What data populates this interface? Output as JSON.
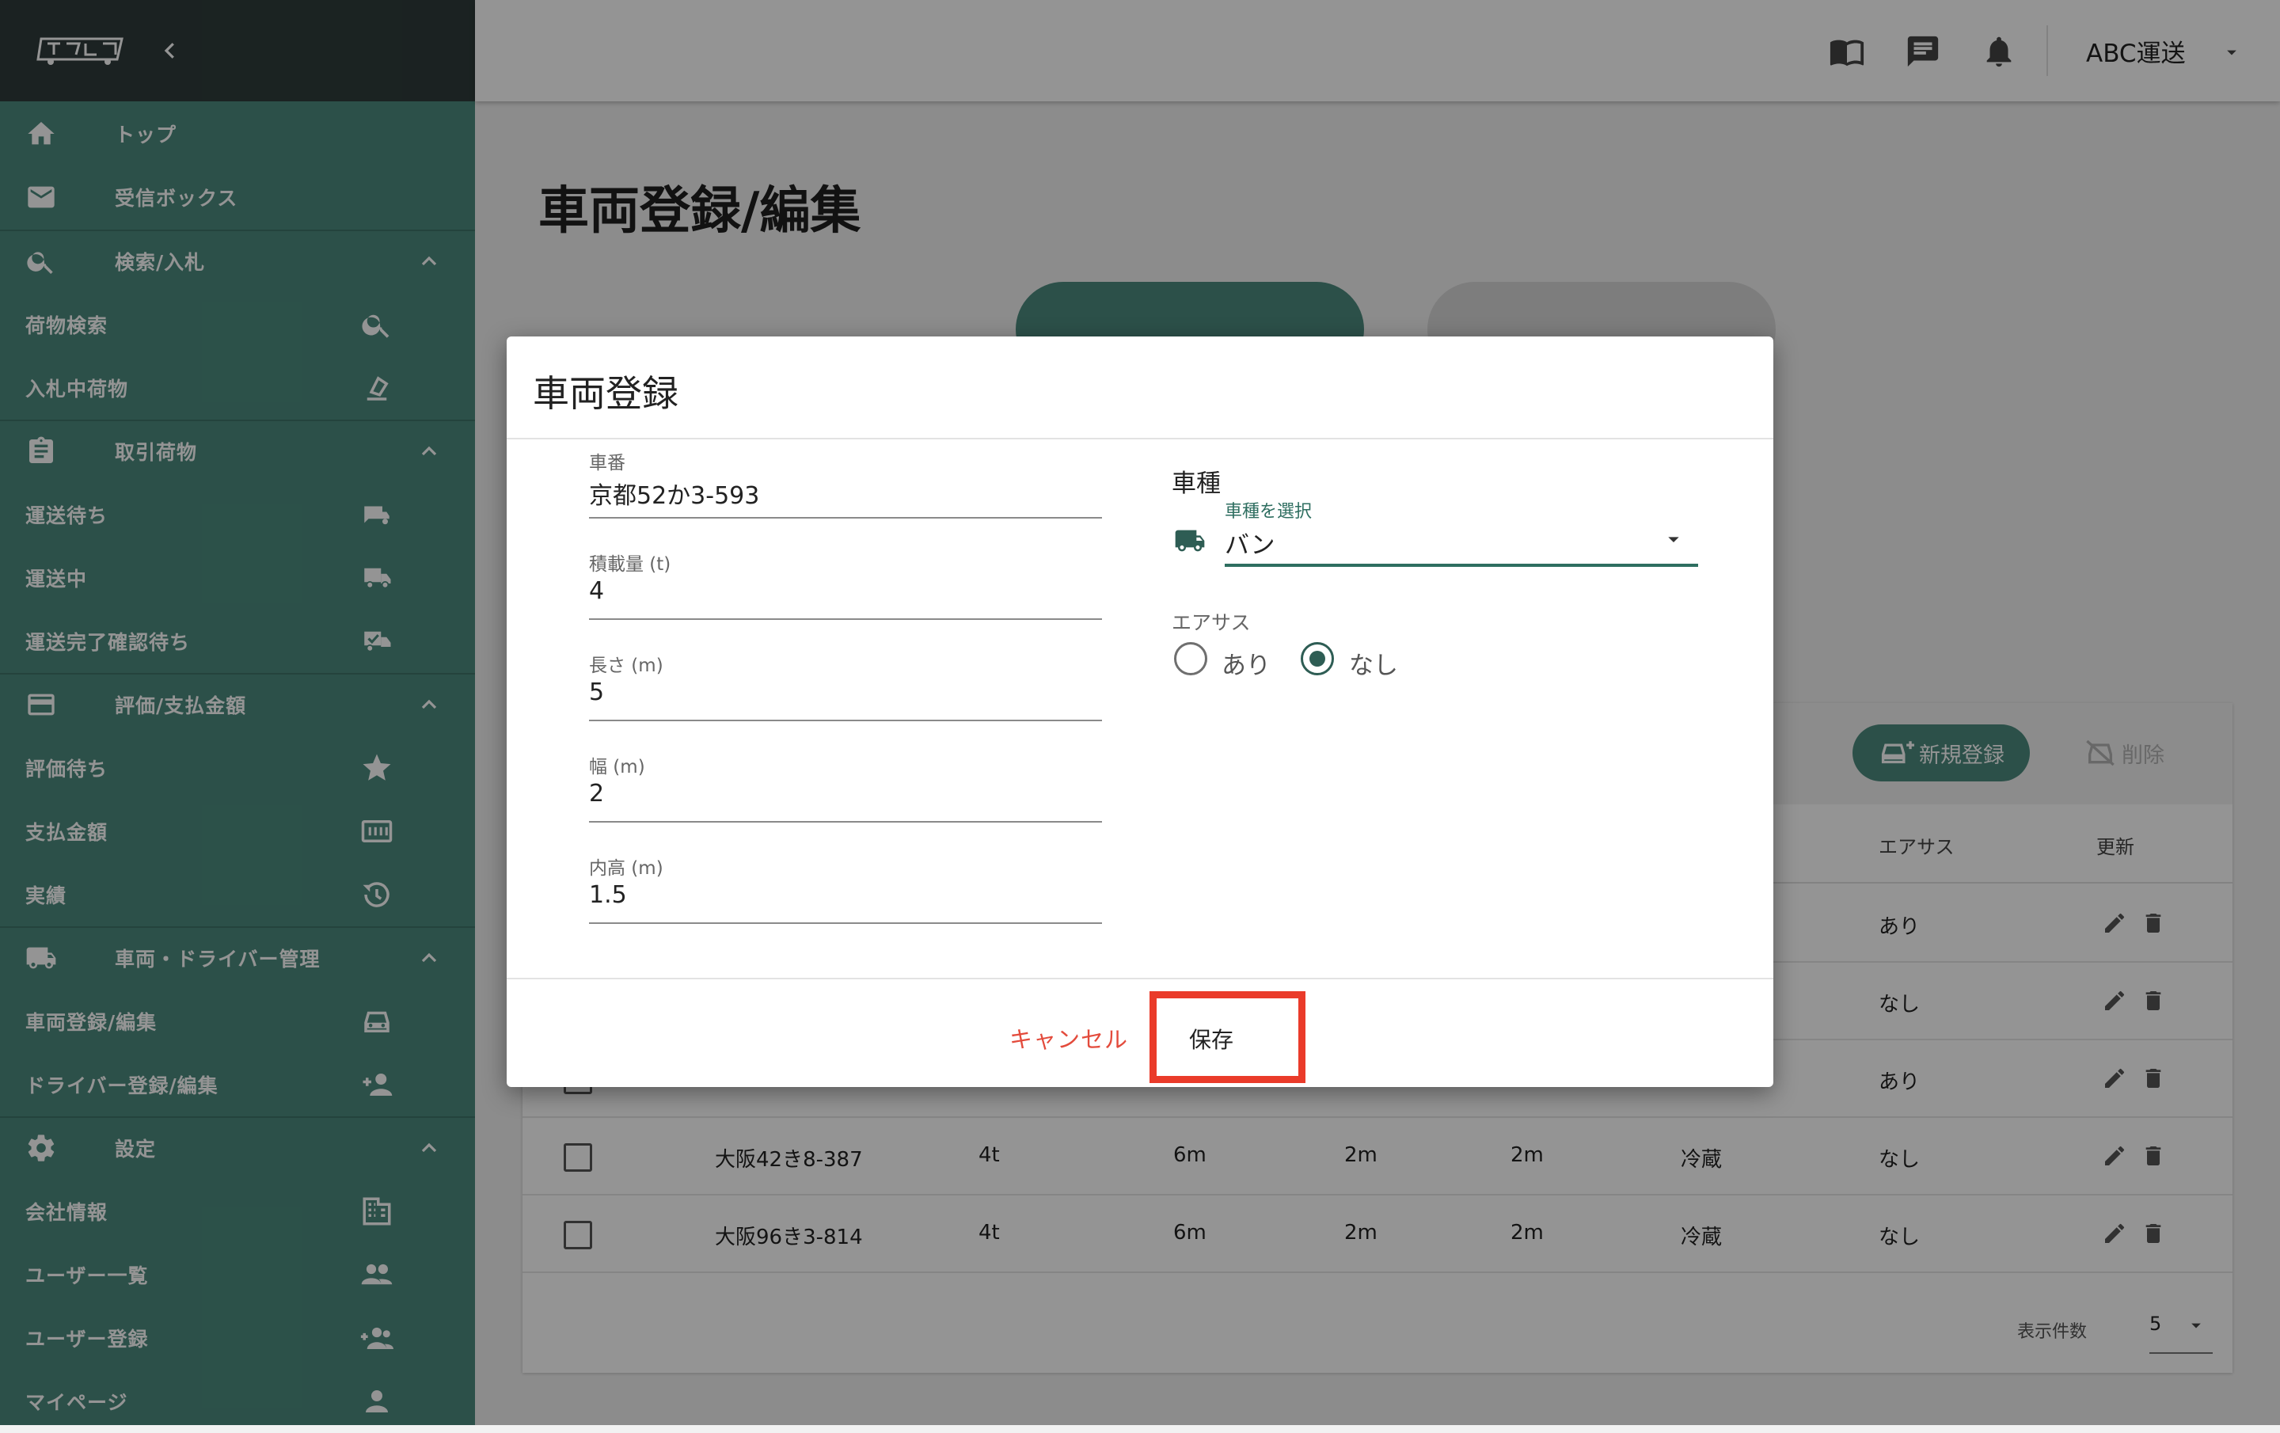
{
  "sidebar": {
    "top": "トップ",
    "inbox": "受信ボックス",
    "search_bid": {
      "label": "検索/入札",
      "items": [
        "荷物検索",
        "入札中荷物"
      ]
    },
    "deals": {
      "label": "取引荷物",
      "items": [
        "運送待ち",
        "運送中",
        "運送完了確認待ち"
      ]
    },
    "rating": {
      "label": "評価/支払金額",
      "items": [
        "評価待ち",
        "支払金額",
        "実績"
      ]
    },
    "vehicles": {
      "label": "車両・ドライバー管理",
      "items": [
        "車両登録/編集",
        "ドライバー登録/編集"
      ]
    },
    "settings": {
      "label": "設定",
      "items": [
        "会社情報",
        "ユーザー一覧",
        "ユーザー登録",
        "マイページ"
      ]
    }
  },
  "header": {
    "company": "ABC運送"
  },
  "page": {
    "title": "車両登録/編集"
  },
  "table": {
    "new_button": "新規登録",
    "delete_button": "削除",
    "headers": {
      "air": "エアサス",
      "update": "更新"
    },
    "rows": [
      {
        "air": "あり"
      },
      {
        "air": "なし"
      },
      {
        "air": "あり"
      },
      {
        "plate": "大阪42き8-387",
        "load": "4t",
        "length": "6m",
        "width": "2m",
        "height": "2m",
        "type": "冷蔵",
        "air": "なし"
      },
      {
        "plate": "大阪96き3-814",
        "load": "4t",
        "length": "6m",
        "width": "2m",
        "height": "2m",
        "type": "冷蔵",
        "air": "なし"
      }
    ],
    "pager_label": "表示件数",
    "pager_value": "5"
  },
  "dialog": {
    "title": "車両登録",
    "fields": [
      {
        "label": "車番",
        "value": "京都52か3-593"
      },
      {
        "label": "積載量 (t)",
        "value": "4"
      },
      {
        "label": "長さ (m)",
        "value": "5"
      },
      {
        "label": "幅 (m)",
        "value": "2"
      },
      {
        "label": "内高 (m)",
        "value": "1.5"
      }
    ],
    "vehicle_type": {
      "heading": "車種",
      "select_label": "車種を選択",
      "value": "バン"
    },
    "air_suspension": {
      "label": "エアサス",
      "options": [
        "あり",
        "なし"
      ],
      "selected": "なし"
    },
    "cancel": "キャンセル",
    "save": "保存"
  },
  "colors": {
    "brand": "#4c8b7e",
    "sidebar_header": "#2f3c3b",
    "accent_dark": "#2e6e60",
    "cancel": "#e34b3c",
    "highlight": "#ea3b2a"
  }
}
